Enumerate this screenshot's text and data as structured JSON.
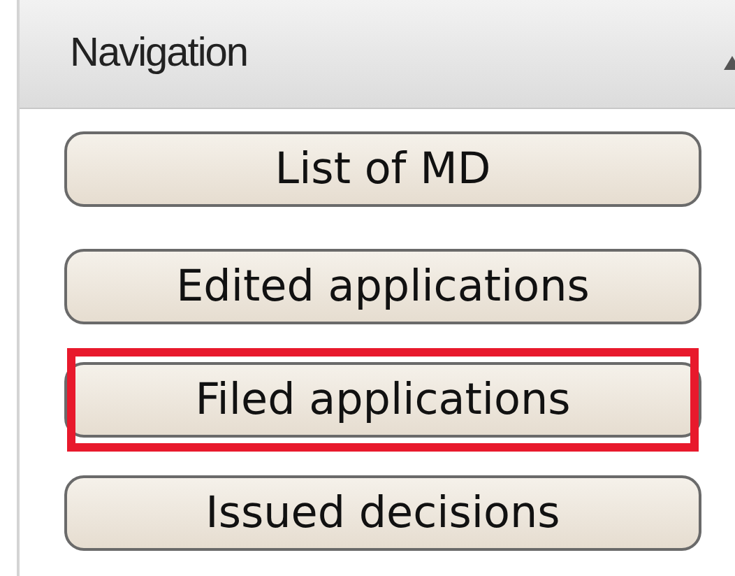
{
  "panel": {
    "title": "Navigation",
    "collapsed": false
  },
  "buttons": [
    {
      "label": "List of MD",
      "highlighted": false
    },
    {
      "label": "Edited applications",
      "highlighted": false
    },
    {
      "label": "Filed applications",
      "highlighted": true
    },
    {
      "label": "Issued decisions",
      "highlighted": false
    }
  ]
}
